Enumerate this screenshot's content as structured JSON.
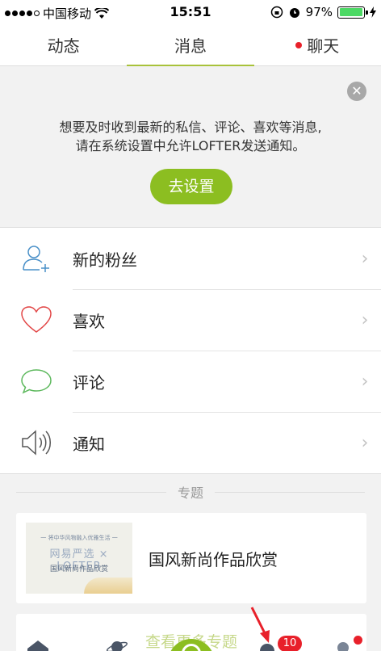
{
  "status_bar": {
    "carrier": "中国移动",
    "time": "15:51",
    "battery": "97%",
    "battery_level": 0.97
  },
  "tabs": [
    {
      "label": "动态",
      "active": false,
      "has_dot": false
    },
    {
      "label": "消息",
      "active": true,
      "has_dot": false
    },
    {
      "label": "聊天",
      "active": false,
      "has_dot": true
    }
  ],
  "banner": {
    "line1": "想要及时收到最新的私信、评论、喜欢等消息,",
    "line2": "请在系统设置中允许LOFTER发送通知。",
    "button_label": "去设置",
    "close_icon": "close-icon"
  },
  "messages": [
    {
      "label": "新的粉丝",
      "icon": "add-user-icon",
      "icon_color": "#4a90c8"
    },
    {
      "label": "喜欢",
      "icon": "heart-icon",
      "icon_color": "#e24646"
    },
    {
      "label": "评论",
      "icon": "comment-icon",
      "icon_color": "#5cb85c"
    },
    {
      "label": "通知",
      "icon": "speaker-icon",
      "icon_color": "#555555"
    }
  ],
  "topics": {
    "section_title": "专题",
    "items": [
      {
        "title": "国风新尚作品欣赏",
        "image_tagline": "一 将中华风物融入优雅生活 一",
        "image_brand": "网易严选 × LOFTER",
        "image_subtitle": "国风新尚作品欣赏"
      }
    ],
    "more_label": "查看更多专题"
  },
  "bottom_nav": {
    "message_badge": "10"
  },
  "colors": {
    "accent": "#8cbe21",
    "badge": "#e8202a"
  }
}
